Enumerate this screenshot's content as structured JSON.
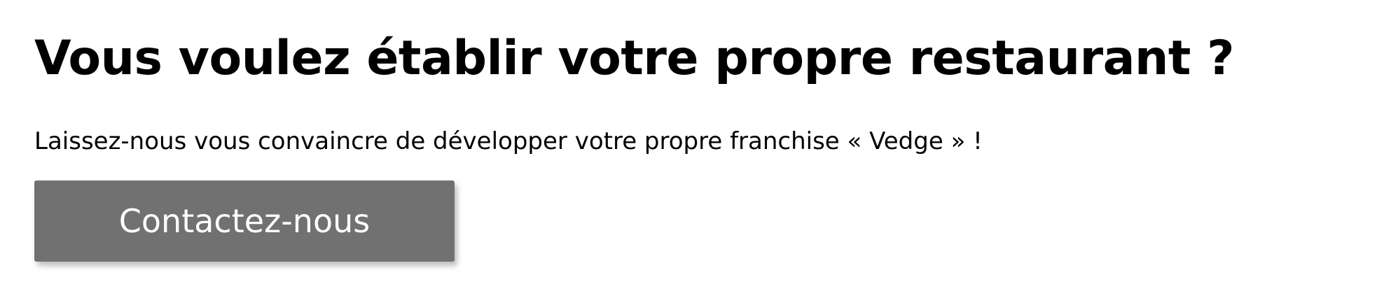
{
  "hero": {
    "title": "Vous voulez établir votre propre restaurant ?",
    "subtitle": "Laissez-nous vous convaincre de développer votre propre franchise « Vedge » !",
    "contact_label": "Contactez-nous"
  },
  "colors": {
    "button_background": "#717171",
    "button_text": "#ffffff",
    "text": "#000000",
    "background": "#ffffff"
  }
}
